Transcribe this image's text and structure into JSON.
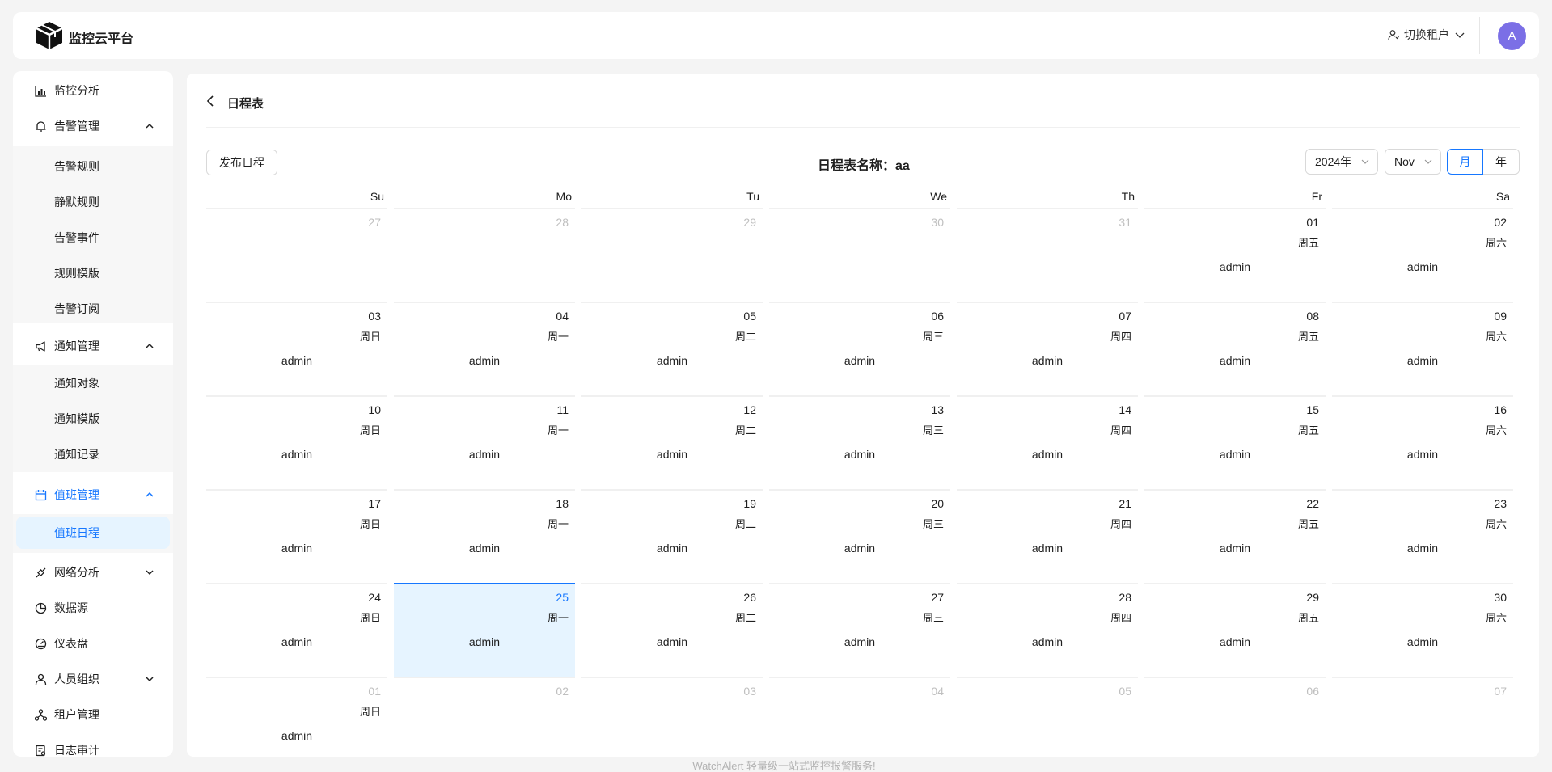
{
  "header": {
    "brand": "监控云平台",
    "tenant_switch": "切换租户",
    "avatar_initial": "A"
  },
  "sidebar": {
    "items": [
      {
        "label": "监控分析",
        "icon": "chart-icon"
      },
      {
        "label": "告警管理",
        "icon": "bell-icon",
        "expanded": true,
        "children": [
          "告警规则",
          "静默规则",
          "告警事件",
          "规则模版",
          "告警订阅"
        ]
      },
      {
        "label": "通知管理",
        "icon": "megaphone-icon",
        "expanded": true,
        "children": [
          "通知对象",
          "通知模版",
          "通知记录"
        ]
      },
      {
        "label": "值班管理",
        "icon": "calendar-icon",
        "expanded": true,
        "active": true,
        "children": [
          "值班日程"
        ]
      },
      {
        "label": "网络分析",
        "icon": "satellite-icon",
        "expanded": false
      },
      {
        "label": "数据源",
        "icon": "pie-icon"
      },
      {
        "label": "仪表盘",
        "icon": "dashboard-icon"
      },
      {
        "label": "人员组织",
        "icon": "user-icon",
        "expanded": false
      },
      {
        "label": "租户管理",
        "icon": "tenant-tree-icon"
      },
      {
        "label": "日志审计",
        "icon": "audit-icon"
      }
    ],
    "active_sub": "值班日程"
  },
  "main": {
    "title": "日程表",
    "publish_button": "发布日程",
    "schedule_name": "日程表名称：aa",
    "year_select": "2024年",
    "month_select": "Nov",
    "mode_month": "月",
    "mode_year": "年"
  },
  "calendar": {
    "weekdays": [
      "Su",
      "Mo",
      "Tu",
      "We",
      "Th",
      "Fr",
      "Sa"
    ],
    "weeks": [
      [
        {
          "day": "27",
          "other": true
        },
        {
          "day": "28",
          "other": true
        },
        {
          "day": "29",
          "other": true
        },
        {
          "day": "30",
          "other": true
        },
        {
          "day": "31",
          "other": true
        },
        {
          "day": "01",
          "weekday": "周五",
          "user": "admin"
        },
        {
          "day": "02",
          "weekday": "周六",
          "user": "admin"
        }
      ],
      [
        {
          "day": "03",
          "weekday": "周日",
          "user": "admin"
        },
        {
          "day": "04",
          "weekday": "周一",
          "user": "admin"
        },
        {
          "day": "05",
          "weekday": "周二",
          "user": "admin"
        },
        {
          "day": "06",
          "weekday": "周三",
          "user": "admin"
        },
        {
          "day": "07",
          "weekday": "周四",
          "user": "admin"
        },
        {
          "day": "08",
          "weekday": "周五",
          "user": "admin"
        },
        {
          "day": "09",
          "weekday": "周六",
          "user": "admin"
        }
      ],
      [
        {
          "day": "10",
          "weekday": "周日",
          "user": "admin"
        },
        {
          "day": "11",
          "weekday": "周一",
          "user": "admin"
        },
        {
          "day": "12",
          "weekday": "周二",
          "user": "admin"
        },
        {
          "day": "13",
          "weekday": "周三",
          "user": "admin"
        },
        {
          "day": "14",
          "weekday": "周四",
          "user": "admin"
        },
        {
          "day": "15",
          "weekday": "周五",
          "user": "admin"
        },
        {
          "day": "16",
          "weekday": "周六",
          "user": "admin"
        }
      ],
      [
        {
          "day": "17",
          "weekday": "周日",
          "user": "admin"
        },
        {
          "day": "18",
          "weekday": "周一",
          "user": "admin"
        },
        {
          "day": "19",
          "weekday": "周二",
          "user": "admin"
        },
        {
          "day": "20",
          "weekday": "周三",
          "user": "admin"
        },
        {
          "day": "21",
          "weekday": "周四",
          "user": "admin"
        },
        {
          "day": "22",
          "weekday": "周五",
          "user": "admin"
        },
        {
          "day": "23",
          "weekday": "周六",
          "user": "admin"
        }
      ],
      [
        {
          "day": "24",
          "weekday": "周日",
          "user": "admin"
        },
        {
          "day": "25",
          "weekday": "周一",
          "user": "admin",
          "today": true
        },
        {
          "day": "26",
          "weekday": "周二",
          "user": "admin"
        },
        {
          "day": "27",
          "weekday": "周三",
          "user": "admin"
        },
        {
          "day": "28",
          "weekday": "周四",
          "user": "admin"
        },
        {
          "day": "29",
          "weekday": "周五",
          "user": "admin"
        },
        {
          "day": "30",
          "weekday": "周六",
          "user": "admin"
        }
      ],
      [
        {
          "day": "01",
          "weekday": "周日",
          "user": "admin",
          "other": true
        },
        {
          "day": "02",
          "other": true
        },
        {
          "day": "03",
          "other": true
        },
        {
          "day": "04",
          "other": true
        },
        {
          "day": "05",
          "other": true
        },
        {
          "day": "06",
          "other": true
        },
        {
          "day": "07",
          "other": true
        }
      ]
    ]
  },
  "footer": "WatchAlert 轻量级一站式监控报警服务!",
  "colors": {
    "accent": "#1677ff",
    "today_bg": "#e6f4ff",
    "avatar_bg": "#7b6fe6"
  }
}
